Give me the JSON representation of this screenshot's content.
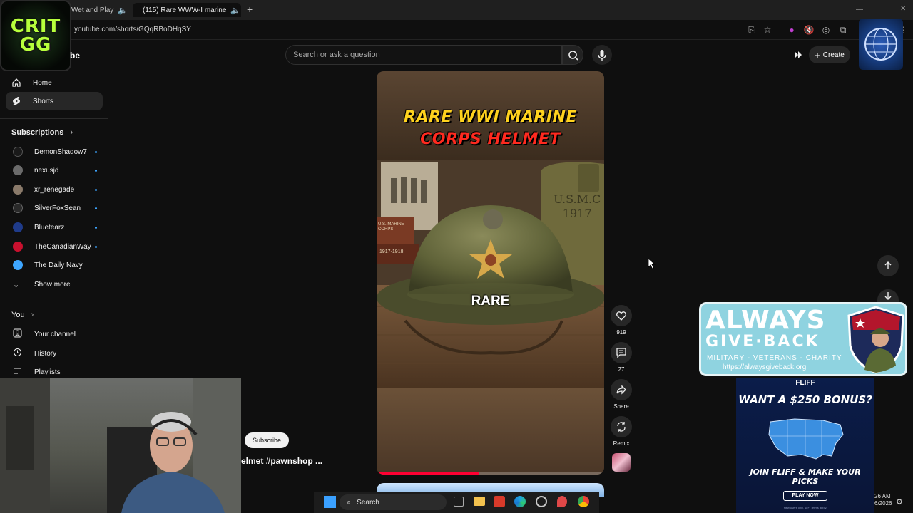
{
  "browser": {
    "tabs": [
      {
        "title": "Wet and Play",
        "active": false
      },
      {
        "title": "(115) Rare WWW-I marine",
        "active": true
      }
    ],
    "url": "youtube.com/shorts/GQqRBoDHqSY"
  },
  "header": {
    "channel_badge_line1": "CRIT",
    "channel_badge_line2": "GG",
    "logo_suffix": "be",
    "search_placeholder": "Search or ask a question",
    "create_label": "Create"
  },
  "sidebar": {
    "home": "Home",
    "shorts": "Shorts",
    "subscriptions_heading": "Subscriptions",
    "subscriptions": [
      {
        "name": "DemonShadow7",
        "color": "#1a1a1a"
      },
      {
        "name": "nexusjd",
        "color": "#6b6b6b"
      },
      {
        "name": "xr_renegade",
        "color": "#8a7a6a"
      },
      {
        "name": "SilverFoxSean",
        "color": "#2a2a2a"
      },
      {
        "name": "Bluetearz",
        "color": "#1f3b8a"
      },
      {
        "name": "TheCanadianWay",
        "color": "#c8102e"
      },
      {
        "name": "The Daily Navy",
        "color": "#3ea6ff"
      }
    ],
    "show_more": "Show more",
    "you_heading": "You",
    "your_channel": "Your channel",
    "history": "History",
    "playlists": "Playlists"
  },
  "video": {
    "title_line1": "RARE WWI MARINE",
    "title_line2": "CORPS HELMET",
    "caption": "RARE",
    "book_spine_line1": "U.S. MARINE",
    "book_spine_line2": "CORPS",
    "book_spine_years": "1917-1918",
    "bag_text_line1": "U.S.M.C",
    "bag_text_line2": "1917",
    "progress": 0.45
  },
  "actions": {
    "likes": "919",
    "comments": "27",
    "share": "Share",
    "remix": "Remix"
  },
  "overlay": {
    "subscribe": "Subscribe",
    "hashtag_text": "elmet #pawnshop ..."
  },
  "ads": {
    "agb_line1": "ALWAYS",
    "agb_line2": "GIVE·BACK",
    "agb_line3": "MILITARY - VETERANS - CHARITY",
    "agb_url": "https://alwaysgiveback.org",
    "fliff_logo": "FLIFF",
    "fliff_headline": "WANT A $250 BONUS?",
    "fliff_sub": "JOIN FLIFF & MAKE YOUR PICKS",
    "fliff_cta": "PLAY NOW",
    "fliff_fine": "New users only. 18+. Terms apply."
  },
  "taskbar": {
    "search_label": "Search",
    "time": "26 AM",
    "date": "6/2026"
  },
  "colors": {
    "background": "#0f0f0f",
    "accent_red": "#ff0033",
    "title_yellow": "#ffd21e",
    "title_red": "#ff2a1f",
    "subscription_dot": "#3ea6ff"
  }
}
